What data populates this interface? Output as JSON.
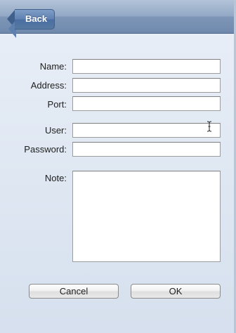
{
  "navbar": {
    "back_label": "Back"
  },
  "form": {
    "name_label": "Name:",
    "address_label": "Address:",
    "port_label": "Port:",
    "user_label": "User:",
    "password_label": "Password:",
    "note_label": "Note:",
    "name_value": "",
    "address_value": "",
    "port_value": "",
    "user_value": "",
    "password_value": "",
    "note_value": ""
  },
  "buttons": {
    "cancel_label": "Cancel",
    "ok_label": "OK"
  },
  "icons": {
    "back": "back-arrow-icon",
    "cursor": "text-cursor-icon"
  },
  "colors": {
    "navbar": "#8aa2c2",
    "background": "#dfe7f2",
    "back_button": "#5f81b2"
  }
}
